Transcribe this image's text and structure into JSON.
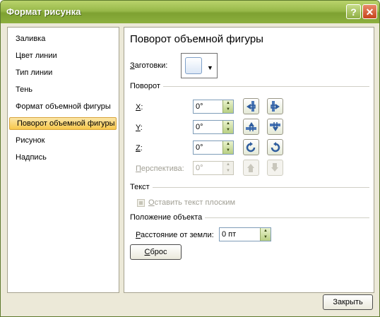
{
  "window": {
    "title": "Формат рисунка"
  },
  "titlebar": {
    "help_glyph": "?",
    "close_glyph": "✕"
  },
  "sidebar": {
    "items": [
      {
        "label": "Заливка"
      },
      {
        "label": "Цвет линии"
      },
      {
        "label": "Тип линии"
      },
      {
        "label": "Тень"
      },
      {
        "label": "Формат объемной фигуры"
      },
      {
        "label": "Поворот объемной фигуры",
        "selected": true
      },
      {
        "label": "Рисунок"
      },
      {
        "label": "Надпись"
      }
    ]
  },
  "panel": {
    "title": "Поворот объемной фигуры",
    "presets_label_u": "З",
    "presets_label_rest": "аготовки:",
    "rotation": {
      "header": "Поворот",
      "x": {
        "label_u": "X",
        "label_rest": ":",
        "value": "0°"
      },
      "y": {
        "label_u": "Y",
        "label_rest": ":",
        "value": "0°"
      },
      "z": {
        "label_u": "Z",
        "label_rest": ":",
        "value": "0°"
      },
      "perspective": {
        "label_u": "П",
        "label_rest": "ерспектива:",
        "value": "0°",
        "enabled": false
      }
    },
    "text": {
      "header": "Текст",
      "keep_flat_u": "О",
      "keep_flat_rest": "ставить текст плоским",
      "keep_flat_enabled": false
    },
    "position": {
      "header": "Положение объекта",
      "distance_label_u": "Р",
      "distance_label_rest": "асстояние от земли:",
      "distance_value": "0 пт"
    },
    "reset_u": "С",
    "reset_rest": "брос"
  },
  "footer": {
    "close_label": "Закрыть"
  },
  "colors": {
    "titlebar": "#8daf3e",
    "selection": "#f7c74b",
    "accent_blue": "#2f5d9e"
  },
  "icons": [
    "help-icon",
    "close-icon",
    "rotate-left-icon",
    "rotate-right-icon",
    "rotate-up-icon",
    "rotate-down-icon",
    "rotate-counterclockwise-icon",
    "rotate-clockwise-icon",
    "perspective-increase-icon",
    "perspective-decrease-icon"
  ]
}
